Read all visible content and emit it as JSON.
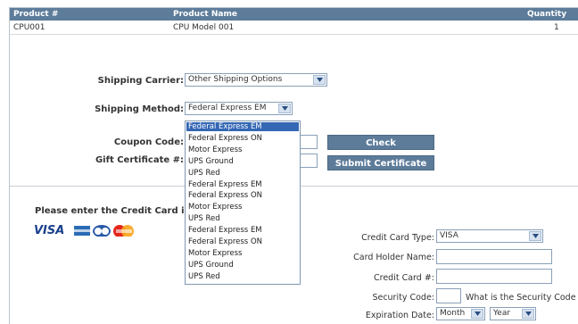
{
  "table": {
    "headers": [
      "Product #",
      "Product Name",
      "Quantity"
    ],
    "rows": [
      {
        "product_no": "CPU001",
        "product_name": "CPU Model 001",
        "quantity": "1"
      }
    ]
  },
  "shipping": {
    "carrier_label": "Shipping Carrier:",
    "carrier_value": "Other Shipping Options",
    "method_label": "Shipping Method:",
    "method_value": "Federal Express EM",
    "method_options": [
      "Federal Express EM",
      "Federal Express ON",
      "Motor Express",
      "UPS Ground",
      "UPS Red",
      "Federal Express EM",
      "Federal Express ON",
      "Motor Express",
      "UPS Red",
      "Federal Express EM",
      "Federal Express ON",
      "Motor Express",
      "UPS Ground",
      "UPS Red"
    ],
    "selected_index": 0
  },
  "coupon": {
    "label": "Coupon Code:",
    "button": "Check"
  },
  "gift": {
    "label": "Gift Certificate #:",
    "button": "Submit Certificate"
  },
  "credit": {
    "heading": "Please enter the Credit Card i",
    "card_logos": [
      "VISA",
      "AMEX",
      "Diners",
      "MasterCard"
    ],
    "type_label": "Credit Card Type:",
    "type_value": "VISA",
    "holder_label": "Card Holder Name:",
    "number_label": "Credit Card #:",
    "security_label": "Security Code:",
    "security_help": "What is the Security Code",
    "expiration_label": "Expiration Date:",
    "month_value": "Month",
    "year_value": "Year"
  },
  "colors": {
    "header_bg": "#5d7c9a",
    "selected_option": "#3467b4"
  }
}
